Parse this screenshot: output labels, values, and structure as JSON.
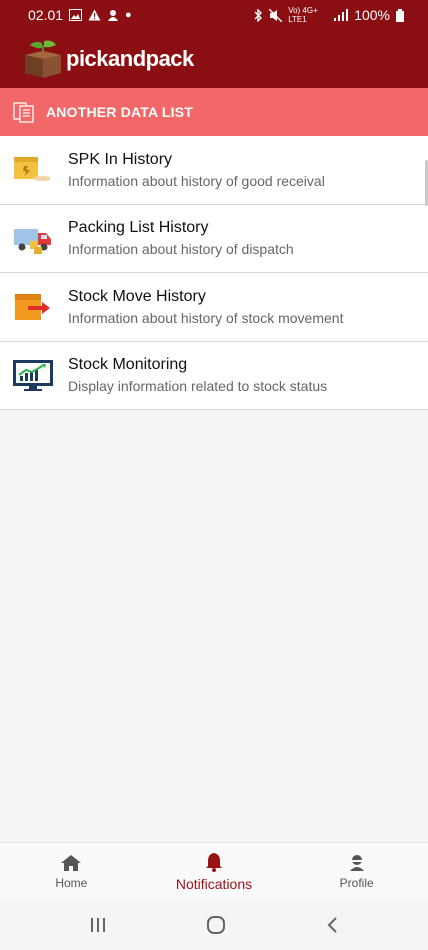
{
  "status_bar": {
    "time": "02.01",
    "battery": "100%",
    "network": "Vo) 4G+ LTE1"
  },
  "header": {
    "app_name": "pickandpack"
  },
  "banner": {
    "title": "ANOTHER DATA LIST"
  },
  "menu_items": [
    {
      "title": "SPK In History",
      "subtitle": "Information about history of good receival"
    },
    {
      "title": "Packing List History",
      "subtitle": "Information about history of dispatch"
    },
    {
      "title": "Stock Move History",
      "subtitle": "Information about history of stock movement"
    },
    {
      "title": "Stock Monitoring",
      "subtitle": "Display information related to stock status"
    }
  ],
  "bottom_nav": {
    "home": "Home",
    "notifications": "Notifications",
    "profile": "Profile"
  },
  "colors": {
    "header": "#8b0f12",
    "banner": "#f26767",
    "active_nav": "#9b1215"
  }
}
